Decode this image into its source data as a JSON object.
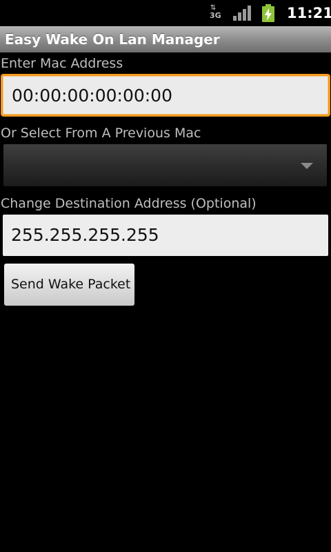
{
  "status_bar": {
    "network_type": "3G",
    "network_activity": "⇅",
    "signal_icon": "signal-strength-icon",
    "battery_icon": "battery-charging-icon",
    "battery_color": "#8fc43a",
    "time": "11:21"
  },
  "app": {
    "title": "Easy Wake On Lan Manager"
  },
  "form": {
    "mac_label": "Enter Mac Address",
    "mac_value": "00:00:00:00:00:00",
    "mac_focus_color": "#f19920",
    "previous_label": "Or Select From A Previous Mac",
    "previous_selected": "",
    "destination_label": "Change Destination Address (Optional)",
    "destination_value": "255.255.255.255",
    "send_button_label": "Send Wake Packet"
  }
}
